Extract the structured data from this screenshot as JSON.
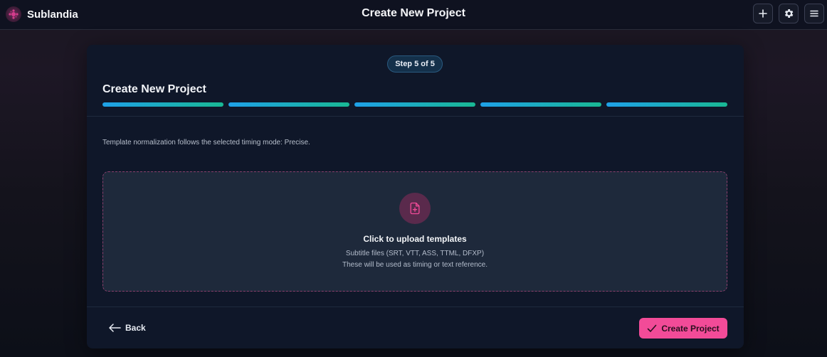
{
  "app": {
    "name": "Sublandia",
    "logo_icon": "sublandia-logo-icon"
  },
  "header": {
    "title": "Create New Project",
    "actions": [
      {
        "name": "add",
        "icon": "plus-icon"
      },
      {
        "name": "settings",
        "icon": "gear-icon"
      },
      {
        "name": "menu",
        "icon": "hamburger-menu-icon"
      }
    ]
  },
  "wizard": {
    "step_label": "Step 5 of 5",
    "title": "Create New Project",
    "progress": {
      "total_steps": 5,
      "completed_steps": 5
    },
    "info": "Template normalization follows the selected timing mode: Precise.",
    "upload": {
      "icon": "file-plus-icon",
      "title": "Click to upload templates",
      "subtitle_formats": "Subtitle files (SRT, VTT, ASS, TTML, DFXP)",
      "subtitle_usage": "These will be used as timing or text reference."
    },
    "back_label": "Back",
    "create_label": "Create Project"
  },
  "colors": {
    "accent_pink": "#f24b98",
    "progress_start": "#1ea1e8",
    "progress_end": "#19b894",
    "card_bg": "#0f1729",
    "dropzone_bg": "#1e293b"
  }
}
